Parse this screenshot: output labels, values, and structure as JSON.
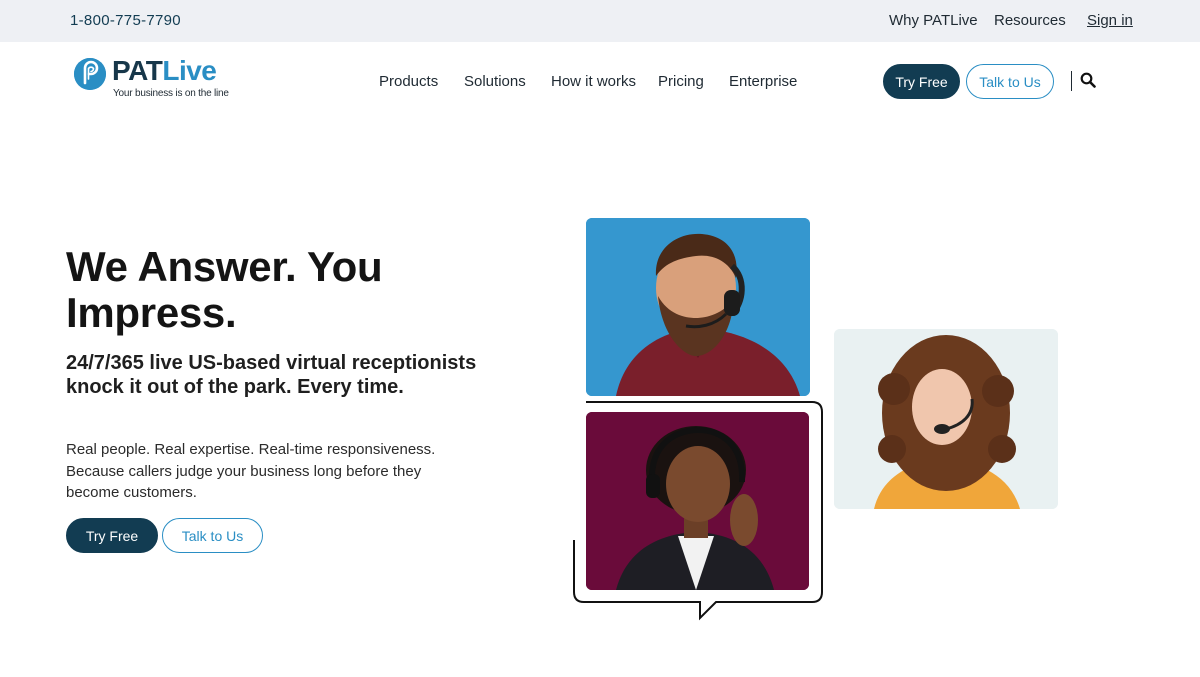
{
  "topbar": {
    "phone": "1-800-775-7790",
    "why": "Why PATLive",
    "resources": "Resources",
    "signin": "Sign in"
  },
  "logo": {
    "brand_pat": "PAT",
    "brand_live": "Live",
    "tagline": "Your business is on the line"
  },
  "nav": {
    "items": [
      {
        "label": "Products"
      },
      {
        "label": "Solutions"
      },
      {
        "label": "How it works"
      },
      {
        "label": "Pricing"
      },
      {
        "label": "Enterprise"
      }
    ],
    "try_free": "Try Free",
    "talk_to_us": "Talk to Us"
  },
  "hero": {
    "title": "We Answer. You Impress.",
    "subtitle": "24/7/365 live US-based virtual receptionists knock it out of the park. Every time.",
    "body": "Real people. Real expertise. Real-time responsiveness. Because callers judge your business long before they become customers.",
    "try_free": "Try Free",
    "talk_to_us": "Talk to Us"
  },
  "colors": {
    "brand_dark": "#123c52",
    "brand_blue": "#2a8ec4",
    "topbar_bg": "#eef0f4"
  },
  "icons": {
    "search": "search-icon",
    "logo_mark": "phone-p-logo-icon"
  }
}
